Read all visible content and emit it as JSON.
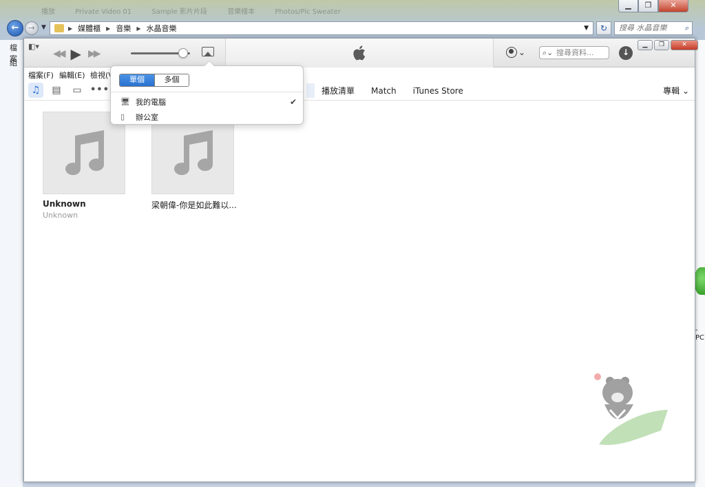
{
  "explorer": {
    "tabs": [
      "播放",
      "Private Video 01",
      "Sample 影片片段",
      "音樂樣本",
      "Photos/Pic Sweater"
    ],
    "breadcrumb": [
      "媒體櫃",
      "音樂",
      "水晶音樂"
    ],
    "search_placeholder": "搜尋 水晶音樂",
    "left_strip": [
      "檔案",
      "組"
    ],
    "right_strip_text": "-PC"
  },
  "itunes": {
    "search_placeholder": "搜尋資料...",
    "menu": [
      "檔案(F)",
      "編輯(E)",
      "檢視(V)"
    ],
    "nav_tabs": [
      "播放清單",
      "Match",
      "iTunes Store"
    ],
    "nav_album_dropdown": "專輯",
    "albums": [
      {
        "title": "Unknown",
        "artist": "Unknown"
      },
      {
        "title": "梁朝偉-你是如此難以...",
        "artist": ""
      }
    ],
    "airplay_popover": {
      "segment_single": "單個",
      "segment_multiple": "多個",
      "devices": [
        {
          "name": "我的電腦",
          "selected": true,
          "icon": "computer-icon"
        },
        {
          "name": "辦公室",
          "selected": false,
          "icon": "speaker-icon"
        }
      ],
      "checkmark": "✔"
    },
    "volume_level": 0.88
  },
  "colors": {
    "accent": "#2a72d0",
    "selected_tab": "#dde8f8"
  }
}
